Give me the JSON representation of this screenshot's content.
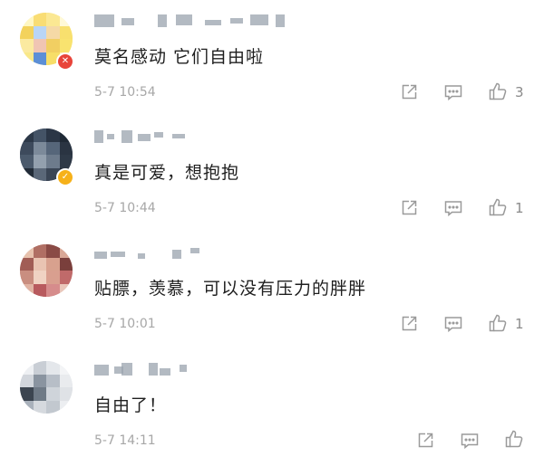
{
  "comments": [
    {
      "text": "莫名感动  它们自由啦",
      "time": "5-7 10:54",
      "likes": "3",
      "badge": "remove-badge-icon"
    },
    {
      "text": "真是可爱，想抱抱",
      "time": "5-7 10:44",
      "likes": "1",
      "badge": "verified-badge-icon"
    },
    {
      "text": "贴膘，羡慕，可以没有压力的胖胖",
      "time": "5-7 10:01",
      "likes": "1",
      "badge": ""
    },
    {
      "text": "自由了！",
      "time": "5-7 14:11",
      "likes": "",
      "badge": ""
    }
  ],
  "icons": {
    "share": "share-icon",
    "reply": "comment-icon",
    "like": "thumbs-up-icon"
  },
  "colors": {
    "text": "#1f1f1f",
    "muted": "#a7a7a7",
    "icon": "#9a9a9a",
    "remove_badge": "#e8443a",
    "verified_badge": "#f6b11a"
  }
}
